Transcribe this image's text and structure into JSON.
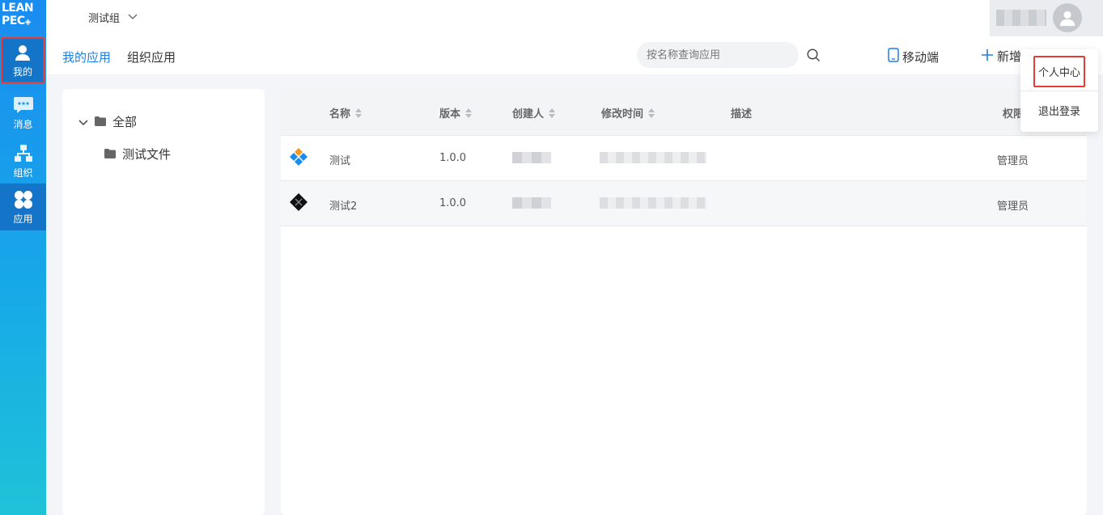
{
  "sidebar": {
    "logo": {
      "line1": "LEAN",
      "line2": "PEC"
    },
    "items": [
      {
        "label": "我的",
        "icon": "user-icon"
      },
      {
        "label": "消息",
        "icon": "message-icon"
      },
      {
        "label": "组织",
        "icon": "org-icon"
      },
      {
        "label": "应用",
        "icon": "apps-icon"
      }
    ]
  },
  "topbar": {
    "group": "测试组"
  },
  "subnav": {
    "tabs": [
      {
        "label": "我的应用"
      },
      {
        "label": "组织应用"
      }
    ],
    "search_placeholder": "按名称查询应用",
    "mobile_label": "移动端",
    "add_label": "新增"
  },
  "tree": {
    "root": "全部",
    "children": [
      "测试文件"
    ]
  },
  "table": {
    "columns": [
      "名称",
      "版本",
      "创建人",
      "修改时间",
      "描述",
      "权限"
    ],
    "rows": [
      {
        "name": "测试",
        "version": "1.0.0",
        "permission": "管理员"
      },
      {
        "name": "测试2",
        "version": "1.0.0",
        "permission": "管理员"
      }
    ]
  },
  "dropdown": {
    "items": [
      "个人中心",
      "退出登录"
    ]
  },
  "colors": {
    "accent": "#1a7fe8",
    "highlight_border": "#e83a35"
  }
}
